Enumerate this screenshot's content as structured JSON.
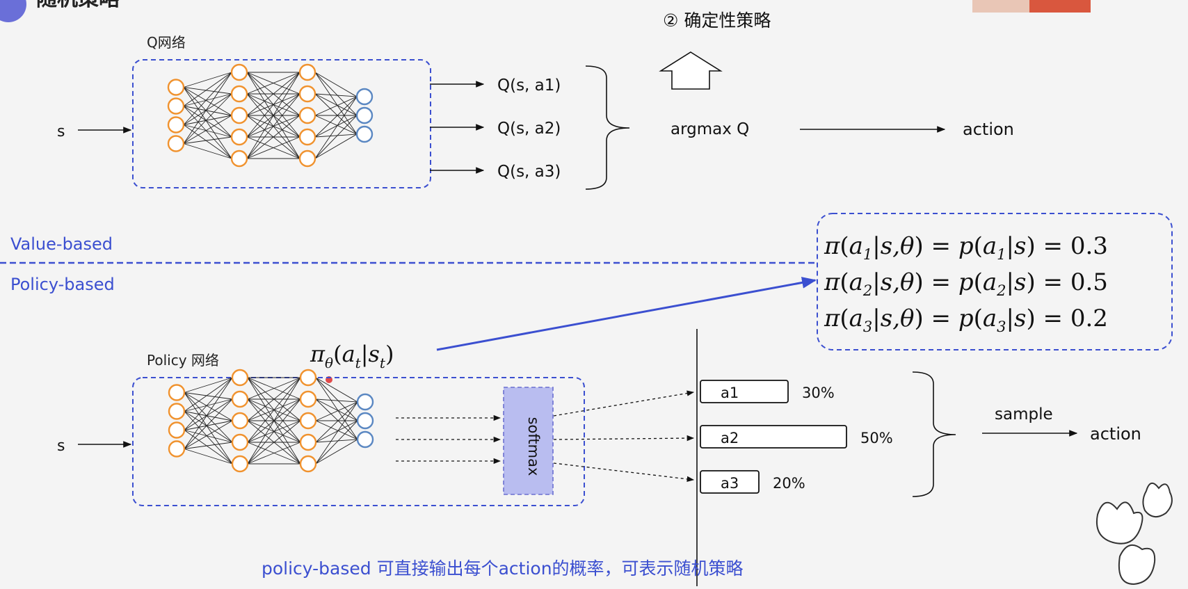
{
  "slide": {
    "title_fragment": "随机策略",
    "deterministic_label": "② 确定性策略",
    "value_based_label": "Value-based",
    "policy_based_label": "Policy-based",
    "caption": "policy-based 可直接输出每个action的概率，可表示随机策略",
    "colors": {
      "accent": "#3b4fd0",
      "neuron": "#f0922e",
      "output_neuron": "#5a87c2",
      "softmax_fill": "#b9bdf0"
    }
  },
  "value_net": {
    "title": "Q网络",
    "input": "s",
    "outputs": [
      "Q(s, a1)",
      "Q(s, a2)",
      "Q(s, a3)"
    ],
    "argmax": "argmax Q",
    "result": "action"
  },
  "policy_net": {
    "title": "Policy 网络",
    "input": "s",
    "formula": "πθ(at|st)",
    "softmax": "softmax",
    "actions": [
      {
        "label": "a1",
        "percent": "30%",
        "prob": 0.3
      },
      {
        "label": "a2",
        "percent": "50%",
        "prob": 0.5
      },
      {
        "label": "a3",
        "percent": "20%",
        "prob": 0.2
      }
    ],
    "sample": "sample",
    "result": "action"
  },
  "prob_box": {
    "lines": [
      {
        "sub": "1",
        "value": "0.3"
      },
      {
        "sub": "2",
        "value": "0.5"
      },
      {
        "sub": "3",
        "value": "0.2"
      }
    ]
  }
}
